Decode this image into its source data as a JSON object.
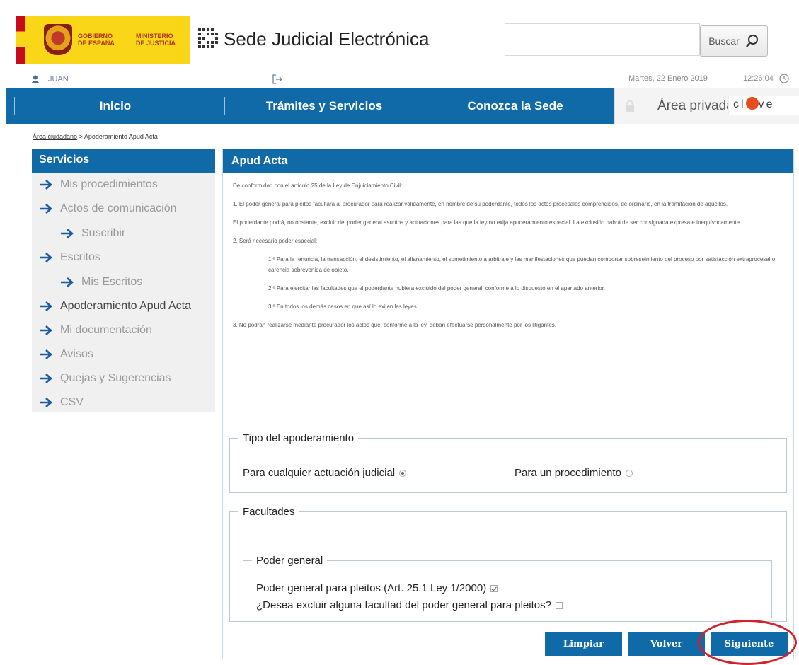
{
  "header": {
    "gov_text_line1": "GOBIERNO",
    "gov_text_line2": "DE ESPAÑA",
    "min_text_line1": "MINISTERIO",
    "min_text_line2": "DE JUSTICIA",
    "title": "Sede Judicial Electrónica",
    "search_button": "Buscar",
    "search_placeholder": "",
    "user_name": "JUAN",
    "date": "Martes, 22 Enero 2019",
    "time": "12:26:04"
  },
  "nav": {
    "items": [
      "Inicio",
      "Trámites y Servicios",
      "Conozca la Sede"
    ],
    "private_area": "Área privada",
    "clave_pre": "cl",
    "clave_post": "ve"
  },
  "breadcrumb": {
    "link": "Área ciudadano",
    "sep": ">",
    "current": "Apoderamiento Apud Acta"
  },
  "sidebar": {
    "title": "Servicios",
    "items": [
      {
        "label": "Mis procedimientos",
        "level": 0
      },
      {
        "label": "Actos de comunicación",
        "level": 0
      },
      {
        "label": "Suscribir",
        "level": 1
      },
      {
        "label": "Escritos",
        "level": 0
      },
      {
        "label": "Mis Escritos",
        "level": 1
      },
      {
        "label": "Apoderamiento Apud Acta",
        "level": 0
      },
      {
        "label": "Mi documentación",
        "level": 0
      },
      {
        "label": "Avisos",
        "level": 0
      },
      {
        "label": "Quejas y Sugerencias",
        "level": 0
      },
      {
        "label": "CSV",
        "level": 0
      }
    ]
  },
  "panel": {
    "title": "Apud Acta",
    "legal": {
      "intro": "De conformidad con el artículo 25 de la Ley de Enjuiciamiento Civil:",
      "p1": "1. El poder general para pleitos facultará al procurador para realizar válidamente, en nombre de su poderdante, todos los actos procesales comprendidos, de ordinario, en la tramitación de aquellos.",
      "p2": "El poderdante podrá, no obstante, excluir del poder general asuntos y actuaciones para las que la ley no exija apoderamiento especial. La exclusión habrá de ser consignada expresa e inequívocamente.",
      "p3": "2. Será necesario poder especial:",
      "p3a": "1.º Para la renuncia, la transacción, el desistimiento, el allanamiento, el sometimiento a arbitraje y las manifestaciones que puedan comportar sobreseimiento del proceso por satisfacción extraprocesal o carencia sobrevenida de objeto.",
      "p3b": "2.º Para ejercitar las facultades que el poderdante hubiera excluido del poder general, conforme a lo dispuesto en el apartado anterior.",
      "p3c": "3.º En todos los demás casos en que así lo exijan las leyes.",
      "p4": "3. No podrán realizarse mediante procurador los actos que, conforme a la ley, deban efectuarse personalmente por los litigantes."
    },
    "tipo": {
      "legend": "Tipo del apoderamiento",
      "option1": "Para cualquier actuación judicial",
      "option1_selected": true,
      "option2": "Para un procedimiento",
      "option2_selected": false
    },
    "facultades": {
      "legend": "Facultades",
      "poder_legend": "Poder general",
      "check1": "Poder general para pleitos (Art. 25.1 Ley 1/2000)",
      "check1_checked": true,
      "check2": "¿Desea excluir alguna facultad del poder general para pleitos?",
      "check2_checked": false
    },
    "buttons": {
      "limpiar": "Limpiar",
      "volver": "Volver",
      "siguiente": "Siguiente"
    }
  },
  "colors": {
    "primary": "#0f6aa7",
    "annotation_circle": "#d4202b",
    "gov_yellow": "#f9d617"
  }
}
